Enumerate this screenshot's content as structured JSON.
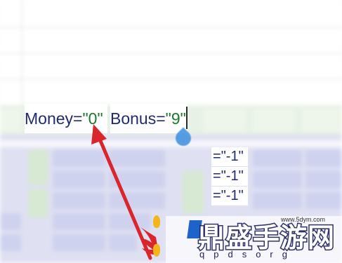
{
  "formula_bar": {
    "money_label": "Money=",
    "money_quote_open": "\"",
    "money_value": "0",
    "money_quote_close": "\"",
    "bonus_label": "Bonus=",
    "bonus_quote_open": "\"",
    "bonus_value": "9",
    "bonus_quote_close": "\""
  },
  "cells": [
    {
      "prefix": "=",
      "value": "\"-1\""
    },
    {
      "prefix": "=",
      "value": "\"-1\""
    },
    {
      "prefix": "=",
      "value": "\"-1\""
    }
  ],
  "annotation": {
    "arrow_color": "#d9262c"
  },
  "watermark": {
    "title": "鼎盛手游网",
    "subtitle": "qpdsorg",
    "url": "www.5dym.com",
    "logo_letter": "R"
  },
  "colors": {
    "formula_text": "#1f2b6e",
    "quote_value": "#1b7a2e",
    "grid_bg": "#dfe0f2",
    "band_green": "#e7f1e5",
    "cursor_handle": "#3d8fe0"
  }
}
